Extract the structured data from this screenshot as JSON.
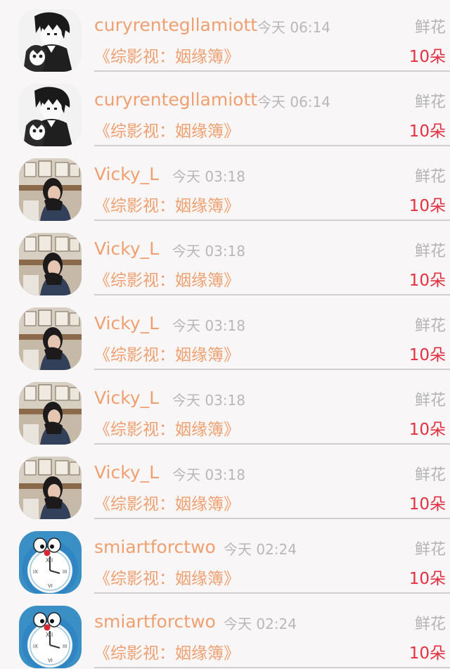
{
  "kind_label": "鲜花",
  "book_title": "《综影视：姻缘簿》",
  "amount_label": "10朵",
  "rows": [
    {
      "user": "curyrentegllamiott",
      "time": "今天 06:14",
      "avatar": "anime"
    },
    {
      "user": "curyrentegllamiott",
      "time": "今天 06:14",
      "avatar": "anime"
    },
    {
      "user": "Vicky_L",
      "time": "今天 03:18",
      "avatar": "photo"
    },
    {
      "user": "Vicky_L",
      "time": "今天 03:18",
      "avatar": "photo"
    },
    {
      "user": "Vicky_L",
      "time": "今天 03:18",
      "avatar": "photo"
    },
    {
      "user": "Vicky_L",
      "time": "今天 03:18",
      "avatar": "photo"
    },
    {
      "user": "Vicky_L",
      "time": "今天 03:18",
      "avatar": "photo"
    },
    {
      "user": "smiartforctwo",
      "time": "今天 02:24",
      "avatar": "doraemon"
    },
    {
      "user": "smiartforctwo",
      "time": "今天 02:24",
      "avatar": "doraemon"
    }
  ],
  "colors": {
    "name": "#f0a070",
    "time": "#b8b8b8",
    "amount": "#e23040",
    "background": "#f8f6f7"
  }
}
